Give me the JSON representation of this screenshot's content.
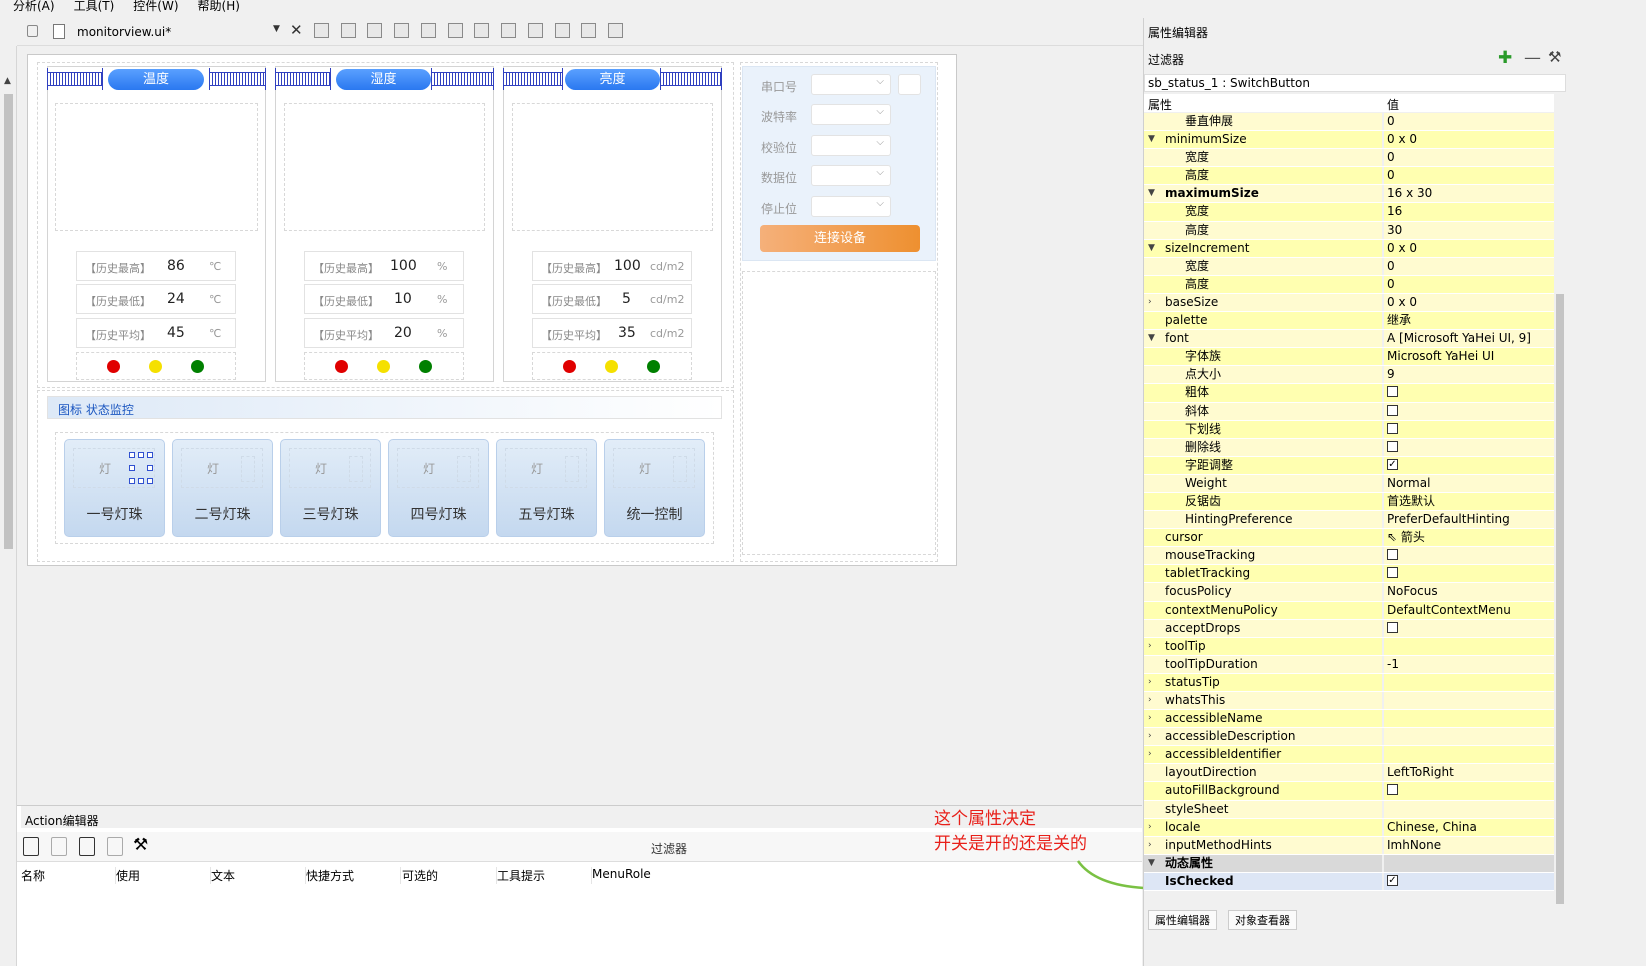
{
  "menubar": [
    "分析(A)",
    "工具(T)",
    "控件(W)",
    "帮助(H)"
  ],
  "doc": {
    "filename": "monitorview.ui*",
    "close_glyph": "✕"
  },
  "form": {
    "panels": [
      {
        "title": "温度",
        "rows": [
          {
            "label": "【历史最高】",
            "value": "86",
            "unit": "℃"
          },
          {
            "label": "【历史最低】",
            "value": "24",
            "unit": "℃"
          },
          {
            "label": "【历史平均】",
            "value": "45",
            "unit": "℃"
          }
        ]
      },
      {
        "title": "湿度",
        "rows": [
          {
            "label": "【历史最高】",
            "value": "100",
            "unit": "%"
          },
          {
            "label": "【历史最低】",
            "value": "10",
            "unit": "%"
          },
          {
            "label": "【历史平均】",
            "value": "20",
            "unit": "%"
          }
        ]
      },
      {
        "title": "亮度",
        "rows": [
          {
            "label": "【历史最高】",
            "value": "100",
            "unit": "cd/m2"
          },
          {
            "label": "【历史最低】",
            "value": "5",
            "unit": "cd/m2"
          },
          {
            "label": "【历史平均】",
            "value": "35",
            "unit": "cd/m2"
          }
        ]
      }
    ],
    "lights": [
      "#e00000",
      "#f5e000",
      "#008000"
    ],
    "serial": {
      "labels": [
        "串口号",
        "波特率",
        "校验位",
        "数据位",
        "停止位"
      ],
      "connect": "连接设备"
    },
    "monitor_title": "图标 状态监控",
    "lamp_char": "灯",
    "lamps": [
      "一号灯珠",
      "二号灯珠",
      "三号灯珠",
      "四号灯珠",
      "五号灯珠",
      "统一控制"
    ]
  },
  "action_editor": {
    "title": "Action编辑器",
    "filter": "过滤器",
    "columns": [
      "名称",
      "使用",
      "文本",
      "快捷方式",
      "可选的",
      "工具提示",
      "MenuRole"
    ]
  },
  "annotation": [
    "这个属性决定",
    "开关是开的还是关的"
  ],
  "prop_editor": {
    "title": "属性编辑器",
    "filter": "过滤器",
    "object": "sb_status_1 : SwitchButton",
    "col_prop": "属性",
    "col_val": "值",
    "tabs": [
      "属性编辑器",
      "对象查看器"
    ],
    "rows": [
      {
        "n": "垂直伸展",
        "v": "0",
        "lvl": 2
      },
      {
        "n": "minimumSize",
        "v": "0 x 0",
        "lvl": 1,
        "exp": "open"
      },
      {
        "n": "宽度",
        "v": "0",
        "lvl": 2
      },
      {
        "n": "高度",
        "v": "0",
        "lvl": 2
      },
      {
        "n": "maximumSize",
        "v": "16 x 30",
        "lvl": 1,
        "exp": "open",
        "bold": true
      },
      {
        "n": "宽度",
        "v": "16",
        "lvl": 2
      },
      {
        "n": "高度",
        "v": "30",
        "lvl": 2
      },
      {
        "n": "sizeIncrement",
        "v": "0 x 0",
        "lvl": 1,
        "exp": "open"
      },
      {
        "n": "宽度",
        "v": "0",
        "lvl": 2
      },
      {
        "n": "高度",
        "v": "0",
        "lvl": 2
      },
      {
        "n": "baseSize",
        "v": "0 x 0",
        "lvl": 1,
        "exp": "closed"
      },
      {
        "n": "palette",
        "v": "继承",
        "lvl": 1
      },
      {
        "n": "font",
        "v": "A  [Microsoft YaHei UI, 9]",
        "lvl": 1,
        "exp": "open"
      },
      {
        "n": "字体族",
        "v": "Microsoft YaHei UI",
        "lvl": 2
      },
      {
        "n": "点大小",
        "v": "9",
        "lvl": 2
      },
      {
        "n": "粗体",
        "v": "",
        "lvl": 2,
        "cb": false
      },
      {
        "n": "斜体",
        "v": "",
        "lvl": 2,
        "cb": false
      },
      {
        "n": "下划线",
        "v": "",
        "lvl": 2,
        "cb": false
      },
      {
        "n": "删除线",
        "v": "",
        "lvl": 2,
        "cb": false
      },
      {
        "n": "字距调整",
        "v": "",
        "lvl": 2,
        "cb": true
      },
      {
        "n": "Weight",
        "v": "Normal",
        "lvl": 2
      },
      {
        "n": "反锯齿",
        "v": "首选默认",
        "lvl": 2
      },
      {
        "n": "HintingPreference",
        "v": "PreferDefaultHinting",
        "lvl": 2
      },
      {
        "n": "cursor",
        "v": "箭头",
        "lvl": 1,
        "cursor": true
      },
      {
        "n": "mouseTracking",
        "v": "",
        "lvl": 1,
        "cb": false
      },
      {
        "n": "tabletTracking",
        "v": "",
        "lvl": 1,
        "cb": false
      },
      {
        "n": "focusPolicy",
        "v": "NoFocus",
        "lvl": 1
      },
      {
        "n": "contextMenuPolicy",
        "v": "DefaultContextMenu",
        "lvl": 1
      },
      {
        "n": "acceptDrops",
        "v": "",
        "lvl": 1,
        "cb": false
      },
      {
        "n": "toolTip",
        "v": "",
        "lvl": 1,
        "exp": "closed"
      },
      {
        "n": "toolTipDuration",
        "v": "-1",
        "lvl": 1
      },
      {
        "n": "statusTip",
        "v": "",
        "lvl": 1,
        "exp": "closed"
      },
      {
        "n": "whatsThis",
        "v": "",
        "lvl": 1,
        "exp": "closed"
      },
      {
        "n": "accessibleName",
        "v": "",
        "lvl": 1,
        "exp": "closed"
      },
      {
        "n": "accessibleDescription",
        "v": "",
        "lvl": 1,
        "exp": "closed"
      },
      {
        "n": "accessibleIdentifier",
        "v": "",
        "lvl": 1,
        "exp": "closed"
      },
      {
        "n": "layoutDirection",
        "v": "LeftToRight",
        "lvl": 1
      },
      {
        "n": "autoFillBackground",
        "v": "",
        "lvl": 1,
        "cb": false
      },
      {
        "n": "styleSheet",
        "v": "",
        "lvl": 1
      },
      {
        "n": "locale",
        "v": "Chinese, China",
        "lvl": 1,
        "exp": "closed"
      },
      {
        "n": "inputMethodHints",
        "v": "ImhNone",
        "lvl": 1,
        "exp": "closed"
      },
      {
        "n": "动态属性",
        "v": "",
        "lvl": 1,
        "exp": "open",
        "sect": true
      },
      {
        "n": "IsChecked",
        "v": "",
        "lvl": 1,
        "cb": true,
        "sel": true
      }
    ]
  }
}
